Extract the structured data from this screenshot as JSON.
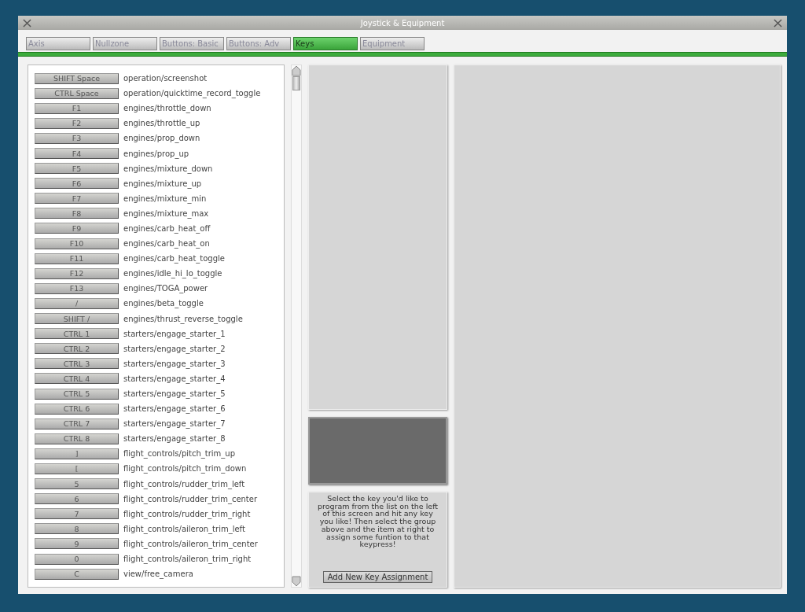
{
  "window": {
    "title": "Joystick & Equipment"
  },
  "tabs": [
    {
      "label": "Axis",
      "selected": false
    },
    {
      "label": "Nullzone",
      "selected": false
    },
    {
      "label": "Buttons: Basic",
      "selected": false
    },
    {
      "label": "Buttons: Adv",
      "selected": false
    },
    {
      "label": "Keys",
      "selected": true
    },
    {
      "label": "Equipment",
      "selected": false
    }
  ],
  "key_list": [
    {
      "key": "SHIFT Space",
      "command": "operation/screenshot"
    },
    {
      "key": "CTRL Space",
      "command": "operation/quicktime_record_toggle"
    },
    {
      "key": "F1",
      "command": "engines/throttle_down"
    },
    {
      "key": "F2",
      "command": "engines/throttle_up"
    },
    {
      "key": "F3",
      "command": "engines/prop_down"
    },
    {
      "key": "F4",
      "command": "engines/prop_up"
    },
    {
      "key": "F5",
      "command": "engines/mixture_down"
    },
    {
      "key": "F6",
      "command": "engines/mixture_up"
    },
    {
      "key": "F7",
      "command": "engines/mixture_min"
    },
    {
      "key": "F8",
      "command": "engines/mixture_max"
    },
    {
      "key": "F9",
      "command": "engines/carb_heat_off"
    },
    {
      "key": "F10",
      "command": "engines/carb_heat_on"
    },
    {
      "key": "F11",
      "command": "engines/carb_heat_toggle"
    },
    {
      "key": "F12",
      "command": "engines/idle_hi_lo_toggle"
    },
    {
      "key": "F13",
      "command": "engines/TOGA_power"
    },
    {
      "key": "/",
      "command": "engines/beta_toggle"
    },
    {
      "key": "SHIFT /",
      "command": "engines/thrust_reverse_toggle"
    },
    {
      "key": "CTRL 1",
      "command": "starters/engage_starter_1"
    },
    {
      "key": "CTRL 2",
      "command": "starters/engage_starter_2"
    },
    {
      "key": "CTRL 3",
      "command": "starters/engage_starter_3"
    },
    {
      "key": "CTRL 4",
      "command": "starters/engage_starter_4"
    },
    {
      "key": "CTRL 5",
      "command": "starters/engage_starter_5"
    },
    {
      "key": "CTRL 6",
      "command": "starters/engage_starter_6"
    },
    {
      "key": "CTRL 7",
      "command": "starters/engage_starter_7"
    },
    {
      "key": "CTRL 8",
      "command": "starters/engage_starter_8"
    },
    {
      "key": "]",
      "command": "flight_controls/pitch_trim_up"
    },
    {
      "key": "[",
      "command": "flight_controls/pitch_trim_down"
    },
    {
      "key": "5",
      "command": "flight_controls/rudder_trim_left"
    },
    {
      "key": "6",
      "command": "flight_controls/rudder_trim_center"
    },
    {
      "key": "7",
      "command": "flight_controls/rudder_trim_right"
    },
    {
      "key": "8",
      "command": "flight_controls/aileron_trim_left"
    },
    {
      "key": "9",
      "command": "flight_controls/aileron_trim_center"
    },
    {
      "key": "0",
      "command": "flight_controls/aileron_trim_right"
    },
    {
      "key": "C",
      "command": "view/free_camera"
    }
  ],
  "help_text": "Select the key you'd like to program from the list on the left of this screen and hit any key you like! Then select the group above and the item at right to assign some funtion to that keypress!",
  "add_button": "Add New Key Assignment"
}
